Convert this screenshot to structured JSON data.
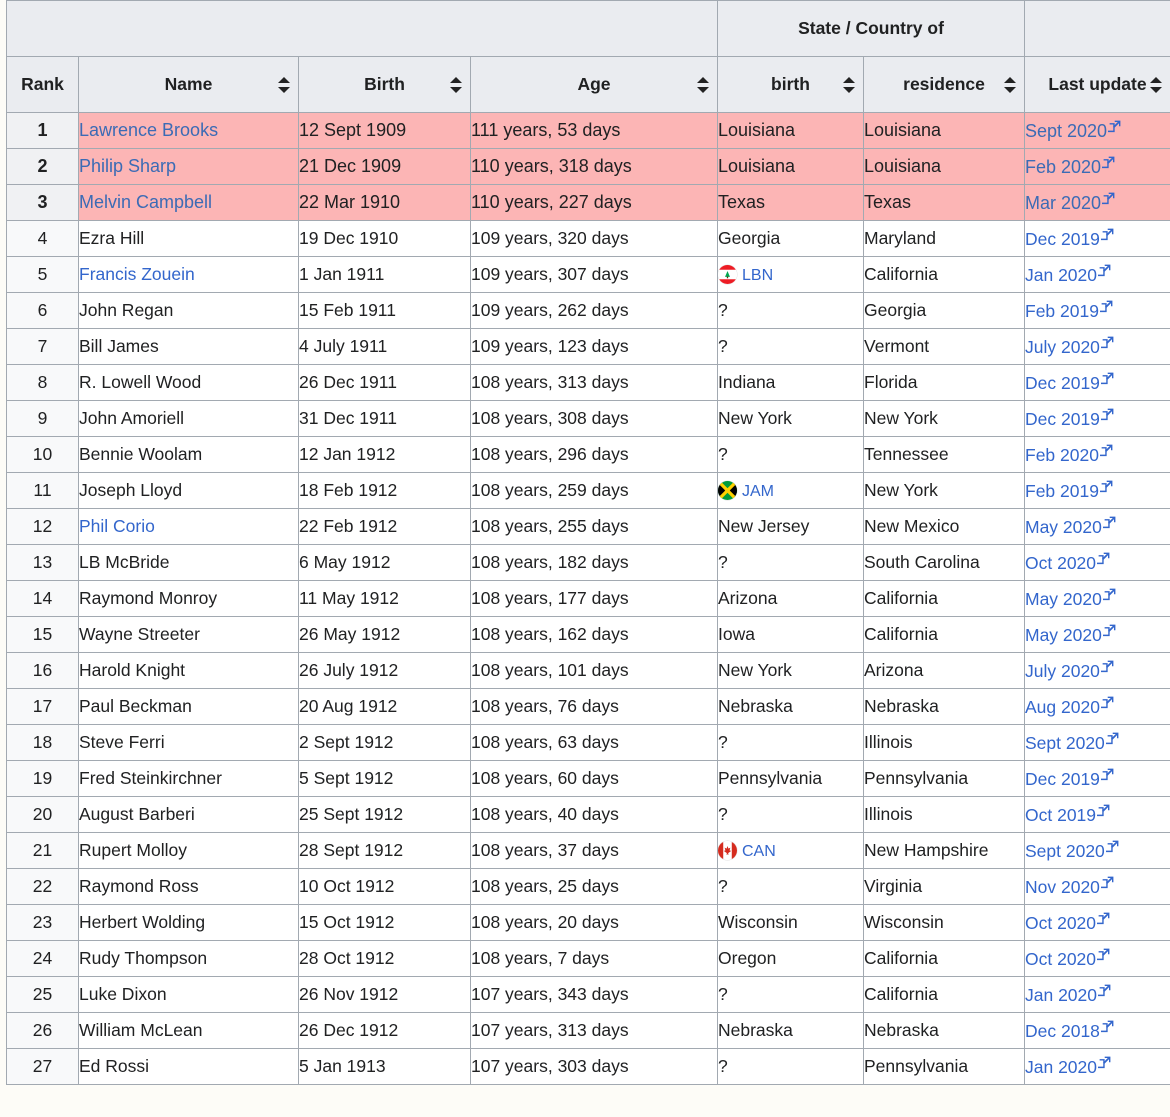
{
  "table": {
    "group_header": {
      "state_country_of": "State / Country of"
    },
    "columns": [
      {
        "key": "rank",
        "label": "Rank",
        "sortable": false
      },
      {
        "key": "name",
        "label": "Name",
        "sortable": true
      },
      {
        "key": "birth",
        "label": "Birth",
        "sortable": true
      },
      {
        "key": "age",
        "label": "Age",
        "sortable": true
      },
      {
        "key": "sbirth",
        "label": "birth",
        "sortable": true
      },
      {
        "key": "sresidence",
        "label": "residence",
        "sortable": true
      },
      {
        "key": "update",
        "label": "Last update",
        "sortable": true
      }
    ],
    "rows": [
      {
        "rank": "1",
        "name": "Lawrence Brooks",
        "name_link": true,
        "birth": "12 Sept 1909",
        "age": "111 years, 53 days",
        "sbirth": "Louisiana",
        "sbirth_flag": null,
        "sresidence": "Louisiana",
        "update": "Sept 2020",
        "highlight": true
      },
      {
        "rank": "2",
        "name": "Philip Sharp",
        "name_link": true,
        "birth": "21 Dec 1909",
        "age": "110 years, 318 days",
        "sbirth": "Louisiana",
        "sbirth_flag": null,
        "sresidence": "Louisiana",
        "update": "Feb 2020",
        "highlight": true
      },
      {
        "rank": "3",
        "name": "Melvin Campbell",
        "name_link": true,
        "birth": "22 Mar 1910",
        "age": "110 years, 227 days",
        "sbirth": "Texas",
        "sbirth_flag": null,
        "sresidence": "Texas",
        "update": "Mar 2020",
        "highlight": true
      },
      {
        "rank": "4",
        "name": "Ezra Hill",
        "name_link": false,
        "birth": "19 Dec 1910",
        "age": "109 years, 320 days",
        "sbirth": "Georgia",
        "sbirth_flag": null,
        "sresidence": "Maryland",
        "update": "Dec 2019",
        "highlight": false
      },
      {
        "rank": "5",
        "name": "Francis Zouein",
        "name_link": true,
        "birth": "1 Jan 1911",
        "age": "109 years, 307 days",
        "sbirth": "LBN",
        "sbirth_flag": "lebanon",
        "sresidence": "California",
        "update": "Jan 2020",
        "highlight": false
      },
      {
        "rank": "6",
        "name": "John Regan",
        "name_link": false,
        "birth": "15 Feb 1911",
        "age": "109 years, 262 days",
        "sbirth": "?",
        "sbirth_flag": null,
        "sresidence": "Georgia",
        "update": "Feb 2019",
        "highlight": false
      },
      {
        "rank": "7",
        "name": "Bill James",
        "name_link": false,
        "birth": "4 July 1911",
        "age": "109 years, 123 days",
        "sbirth": "?",
        "sbirth_flag": null,
        "sresidence": "Vermont",
        "update": "July 2020",
        "highlight": false
      },
      {
        "rank": "8",
        "name": "R. Lowell Wood",
        "name_link": false,
        "birth": "26 Dec 1911",
        "age": "108 years, 313 days",
        "sbirth": "Indiana",
        "sbirth_flag": null,
        "sresidence": "Florida",
        "update": "Dec 2019",
        "highlight": false
      },
      {
        "rank": "9",
        "name": "John Amoriell",
        "name_link": false,
        "birth": "31 Dec 1911",
        "age": "108 years, 308 days",
        "sbirth": "New York",
        "sbirth_flag": null,
        "sresidence": "New York",
        "update": "Dec 2019",
        "highlight": false
      },
      {
        "rank": "10",
        "name": "Bennie Woolam",
        "name_link": false,
        "birth": "12 Jan 1912",
        "age": "108 years, 296 days",
        "sbirth": "?",
        "sbirth_flag": null,
        "sresidence": "Tennessee",
        "update": "Feb 2020",
        "highlight": false
      },
      {
        "rank": "11",
        "name": "Joseph Lloyd",
        "name_link": false,
        "birth": "18 Feb 1912",
        "age": "108 years, 259 days",
        "sbirth": "JAM",
        "sbirth_flag": "jamaica",
        "sresidence": "New York",
        "update": "Feb 2019",
        "highlight": false
      },
      {
        "rank": "12",
        "name": "Phil Corio",
        "name_link": true,
        "birth": "22 Feb 1912",
        "age": "108 years, 255 days",
        "sbirth": "New Jersey",
        "sbirth_flag": null,
        "sresidence": "New Mexico",
        "update": "May 2020",
        "highlight": false
      },
      {
        "rank": "13",
        "name": "LB McBride",
        "name_link": false,
        "birth": "6 May 1912",
        "age": "108 years, 182 days",
        "sbirth": "?",
        "sbirth_flag": null,
        "sresidence": "South Carolina",
        "update": "Oct 2020",
        "highlight": false
      },
      {
        "rank": "14",
        "name": "Raymond Monroy",
        "name_link": false,
        "birth": "11 May 1912",
        "age": "108 years, 177 days",
        "sbirth": "Arizona",
        "sbirth_flag": null,
        "sresidence": "California",
        "update": "May 2020",
        "highlight": false
      },
      {
        "rank": "15",
        "name": "Wayne Streeter",
        "name_link": false,
        "birth": "26 May 1912",
        "age": "108 years, 162 days",
        "sbirth": "Iowa",
        "sbirth_flag": null,
        "sresidence": "California",
        "update": "May 2020",
        "highlight": false
      },
      {
        "rank": "16",
        "name": "Harold Knight",
        "name_link": false,
        "birth": "26 July 1912",
        "age": "108 years, 101 days",
        "sbirth": "New York",
        "sbirth_flag": null,
        "sresidence": "Arizona",
        "update": "July 2020",
        "highlight": false
      },
      {
        "rank": "17",
        "name": "Paul Beckman",
        "name_link": false,
        "birth": "20 Aug 1912",
        "age": "108 years, 76 days",
        "sbirth": "Nebraska",
        "sbirth_flag": null,
        "sresidence": "Nebraska",
        "update": "Aug 2020",
        "highlight": false
      },
      {
        "rank": "18",
        "name": "Steve Ferri",
        "name_link": false,
        "birth": "2 Sept 1912",
        "age": "108 years, 63 days",
        "sbirth": "?",
        "sbirth_flag": null,
        "sresidence": "Illinois",
        "update": "Sept 2020",
        "highlight": false
      },
      {
        "rank": "19",
        "name": "Fred Steinkirchner",
        "name_link": false,
        "birth": "5 Sept 1912",
        "age": "108 years, 60 days",
        "sbirth": "Pennsylvania",
        "sbirth_flag": null,
        "sresidence": "Pennsylvania",
        "update": "Dec 2019",
        "highlight": false
      },
      {
        "rank": "20",
        "name": "August Barberi",
        "name_link": false,
        "birth": "25 Sept 1912",
        "age": "108 years, 40 days",
        "sbirth": "?",
        "sbirth_flag": null,
        "sresidence": "Illinois",
        "update": "Oct 2019",
        "highlight": false
      },
      {
        "rank": "21",
        "name": "Rupert Molloy",
        "name_link": false,
        "birth": "28 Sept 1912",
        "age": "108 years, 37 days",
        "sbirth": "CAN",
        "sbirth_flag": "canada",
        "sresidence": "New Hampshire",
        "update": "Sept 2020",
        "highlight": false
      },
      {
        "rank": "22",
        "name": "Raymond Ross",
        "name_link": false,
        "birth": "10 Oct 1912",
        "age": "108 years, 25 days",
        "sbirth": "?",
        "sbirth_flag": null,
        "sresidence": "Virginia",
        "update": "Nov 2020",
        "highlight": false
      },
      {
        "rank": "23",
        "name": "Herbert Wolding",
        "name_link": false,
        "birth": "15 Oct 1912",
        "age": "108 years, 20 days",
        "sbirth": "Wisconsin",
        "sbirth_flag": null,
        "sresidence": "Wisconsin",
        "update": "Oct 2020",
        "highlight": false
      },
      {
        "rank": "24",
        "name": "Rudy Thompson",
        "name_link": false,
        "birth": "28 Oct 1912",
        "age": "108 years, 7 days",
        "sbirth": "Oregon",
        "sbirth_flag": null,
        "sresidence": "California",
        "update": "Oct 2020",
        "highlight": false
      },
      {
        "rank": "25",
        "name": "Luke Dixon",
        "name_link": false,
        "birth": "26 Nov 1912",
        "age": "107 years, 343 days",
        "sbirth": "?",
        "sbirth_flag": null,
        "sresidence": "California",
        "update": "Jan 2020",
        "highlight": false
      },
      {
        "rank": "26",
        "name": "William McLean",
        "name_link": false,
        "birth": "26 Dec 1912",
        "age": "107 years, 313 days",
        "sbirth": "Nebraska",
        "sbirth_flag": null,
        "sresidence": "Nebraska",
        "update": "Dec 2018",
        "highlight": false
      },
      {
        "rank": "27",
        "name": "Ed Rossi",
        "name_link": false,
        "birth": "5 Jan 1913",
        "age": "107 years, 303 days",
        "sbirth": "?",
        "sbirth_flag": null,
        "sresidence": "Pennsylvania",
        "update": "Jan 2020",
        "highlight": false
      }
    ]
  },
  "icons": {
    "sort": "sort-arrows-icon",
    "external_link": "external-link-icon"
  },
  "colors": {
    "highlight_row": "#fcb5b5",
    "header_bg": "#eaecf0",
    "link": "#3366cc",
    "border": "#a2a9b1",
    "rank_bg": "#f8f9fa",
    "page_bg": "#fdfcf7"
  }
}
